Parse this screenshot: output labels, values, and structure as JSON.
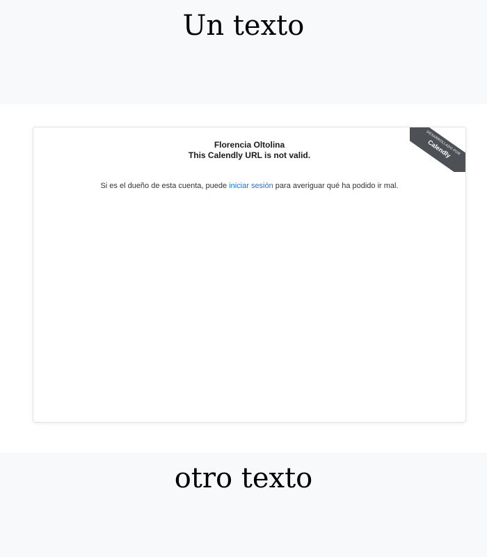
{
  "top": {
    "heading": "Un texto"
  },
  "calendly": {
    "owner_name": "Florencia Oltolina",
    "error_title": "This Calendly URL is not valid.",
    "message_before": "Si es el dueño de esta cuenta, puede ",
    "login_link": "iniciar sesión",
    "message_after": " para averiguar qué ha podido ir mal.",
    "ribbon_small": "DESARROLLADO POR",
    "ribbon_brand": "Calendly"
  },
  "bottom": {
    "heading": "otro texto"
  },
  "colors": {
    "link": "#1a73e8",
    "ribbon": "#4d5055"
  }
}
